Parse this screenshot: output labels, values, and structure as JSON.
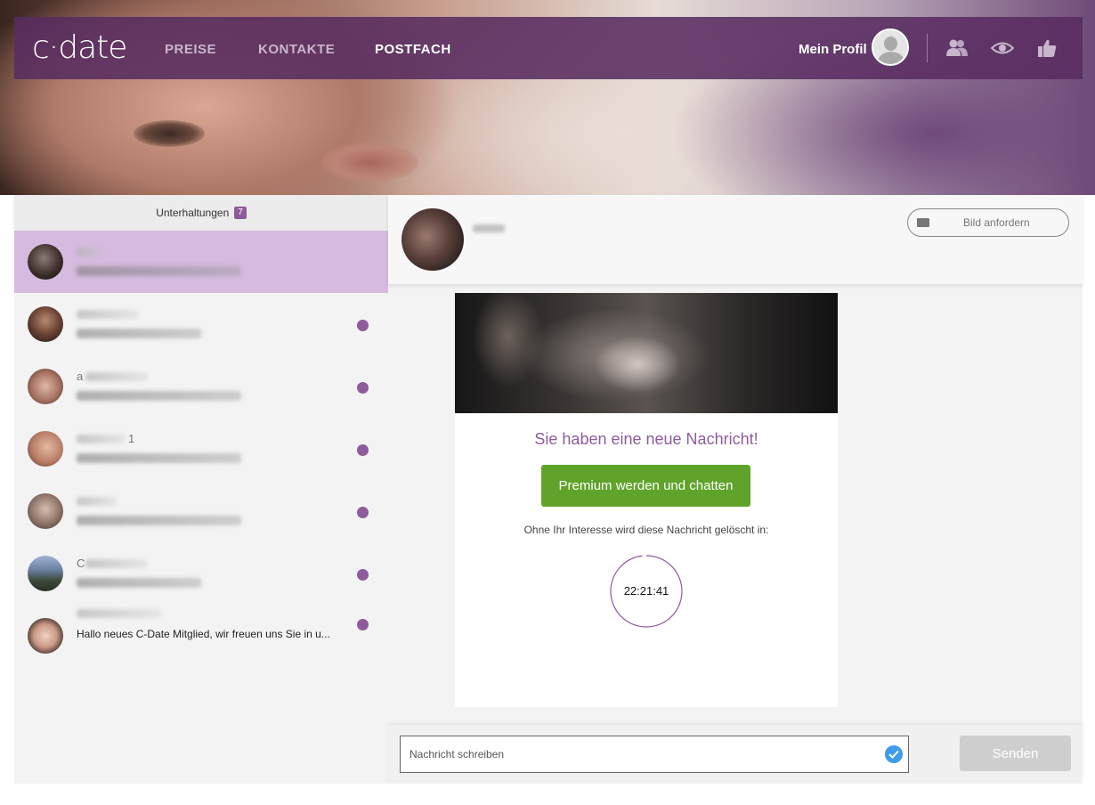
{
  "header": {
    "logo": "c·date",
    "nav": [
      {
        "label": "PREISE",
        "active": false
      },
      {
        "label": "KONTAKTE",
        "active": false
      },
      {
        "label": "POSTFACH",
        "active": true
      }
    ],
    "profile_label": "Mein Profil",
    "icons": [
      "contacts-icon",
      "visitors-eye-icon",
      "likes-thumb-icon"
    ]
  },
  "sidebar": {
    "title": "Unterhaltungen",
    "badge_count": "7",
    "conversations": [
      {
        "name": "",
        "preview": "",
        "unread": false,
        "active": true
      },
      {
        "name": "",
        "preview": "",
        "unread": true,
        "active": false
      },
      {
        "name": "a",
        "preview": "",
        "unread": true,
        "active": false
      },
      {
        "name": "1",
        "preview": "",
        "unread": true,
        "active": false
      },
      {
        "name": "",
        "preview": "",
        "unread": true,
        "active": false
      },
      {
        "name": "C",
        "preview": "",
        "unread": true,
        "active": false
      },
      {
        "name": "",
        "preview": "Hallo neues C-Date Mitglied, wir freuen uns Sie in u...",
        "unread": true,
        "active": false
      }
    ]
  },
  "chat": {
    "request_image_label": "Bild anfordern",
    "card": {
      "title": "Sie haben eine neue Nachricht!",
      "button_label": "Premium werden und chatten",
      "note": "Ohne Ihr Interesse wird diese Nachricht gelöscht in:",
      "countdown": "22:21:41",
      "countdown_fraction": 0.98
    },
    "composer": {
      "placeholder": "Nachricht schreiben",
      "send_label": "Senden"
    }
  },
  "colors": {
    "brand_purple": "#8e5b9c",
    "nav_bg": "#582c60",
    "premium_green": "#5fa32a",
    "active_conversation": "#d6badf",
    "send_disabled": "#cfcfcf"
  }
}
